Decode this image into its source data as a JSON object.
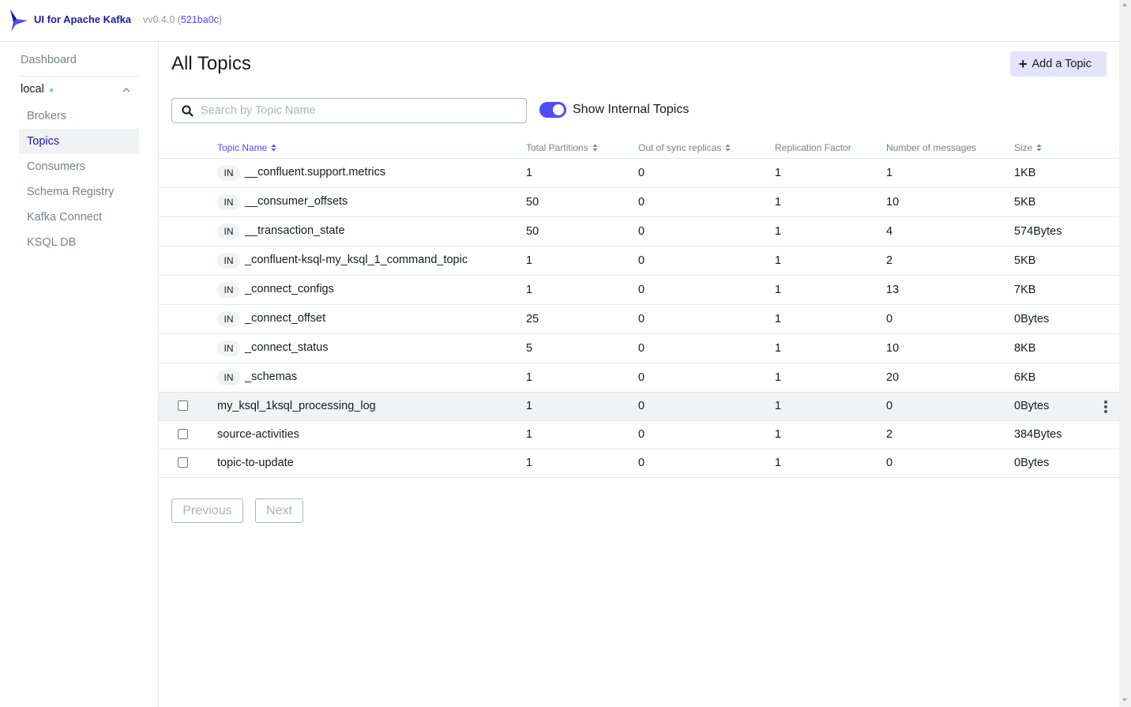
{
  "header": {
    "brand": "UI for Apache Kafka",
    "version_prefix": "vv0.4.0 (",
    "commit": "521ba0c",
    "version_suffix": ")"
  },
  "sidebar": {
    "dashboard": "Dashboard",
    "cluster_name": "local",
    "cluster_status_color": "#5cd685",
    "items": [
      {
        "label": "Brokers",
        "active": false
      },
      {
        "label": "Topics",
        "active": true
      },
      {
        "label": "Consumers",
        "active": false
      },
      {
        "label": "Schema Registry",
        "active": false
      },
      {
        "label": "Kafka Connect",
        "active": false
      },
      {
        "label": "KSQL DB",
        "active": false
      }
    ]
  },
  "main": {
    "title": "All Topics",
    "add_button": "Add a Topic",
    "search_placeholder": "Search by Topic Name",
    "search_value": "",
    "show_internal_label": "Show Internal Topics",
    "show_internal_on": true,
    "accent": "#4c4cff"
  },
  "table": {
    "columns": [
      {
        "label": "Topic Name",
        "sortable": true,
        "sorted": true
      },
      {
        "label": "Total Partitions",
        "sortable": true,
        "sorted": false
      },
      {
        "label": "Out of sync replicas",
        "sortable": true,
        "sorted": false
      },
      {
        "label": "Replication Factor",
        "sortable": false,
        "sorted": false
      },
      {
        "label": "Number of messages",
        "sortable": false,
        "sorted": false
      },
      {
        "label": "Size",
        "sortable": true,
        "sorted": false
      }
    ],
    "internal_badge": "IN",
    "rows": [
      {
        "name": "__confluent.support.metrics",
        "internal": true,
        "partitions": "1",
        "out_of_sync": "0",
        "replication": "1",
        "messages": "1",
        "size": "1KB"
      },
      {
        "name": "__consumer_offsets",
        "internal": true,
        "partitions": "50",
        "out_of_sync": "0",
        "replication": "1",
        "messages": "10",
        "size": "5KB"
      },
      {
        "name": "__transaction_state",
        "internal": true,
        "partitions": "50",
        "out_of_sync": "0",
        "replication": "1",
        "messages": "4",
        "size": "574Bytes"
      },
      {
        "name": "_confluent-ksql-my_ksql_1_command_topic",
        "internal": true,
        "partitions": "1",
        "out_of_sync": "0",
        "replication": "1",
        "messages": "2",
        "size": "5KB"
      },
      {
        "name": "_connect_configs",
        "internal": true,
        "partitions": "1",
        "out_of_sync": "0",
        "replication": "1",
        "messages": "13",
        "size": "7KB"
      },
      {
        "name": "_connect_offset",
        "internal": true,
        "partitions": "25",
        "out_of_sync": "0",
        "replication": "1",
        "messages": "0",
        "size": "0Bytes"
      },
      {
        "name": "_connect_status",
        "internal": true,
        "partitions": "5",
        "out_of_sync": "0",
        "replication": "1",
        "messages": "10",
        "size": "8KB"
      },
      {
        "name": "_schemas",
        "internal": true,
        "partitions": "1",
        "out_of_sync": "0",
        "replication": "1",
        "messages": "20",
        "size": "6KB"
      },
      {
        "name": "my_ksql_1ksql_processing_log",
        "internal": false,
        "hovered": true,
        "partitions": "1",
        "out_of_sync": "0",
        "replication": "1",
        "messages": "0",
        "size": "0Bytes"
      },
      {
        "name": "source-activities",
        "internal": false,
        "partitions": "1",
        "out_of_sync": "0",
        "replication": "1",
        "messages": "2",
        "size": "384Bytes"
      },
      {
        "name": "topic-to-update",
        "internal": false,
        "partitions": "1",
        "out_of_sync": "0",
        "replication": "1",
        "messages": "0",
        "size": "0Bytes"
      }
    ]
  },
  "pagination": {
    "previous": "Previous",
    "next": "Next"
  }
}
